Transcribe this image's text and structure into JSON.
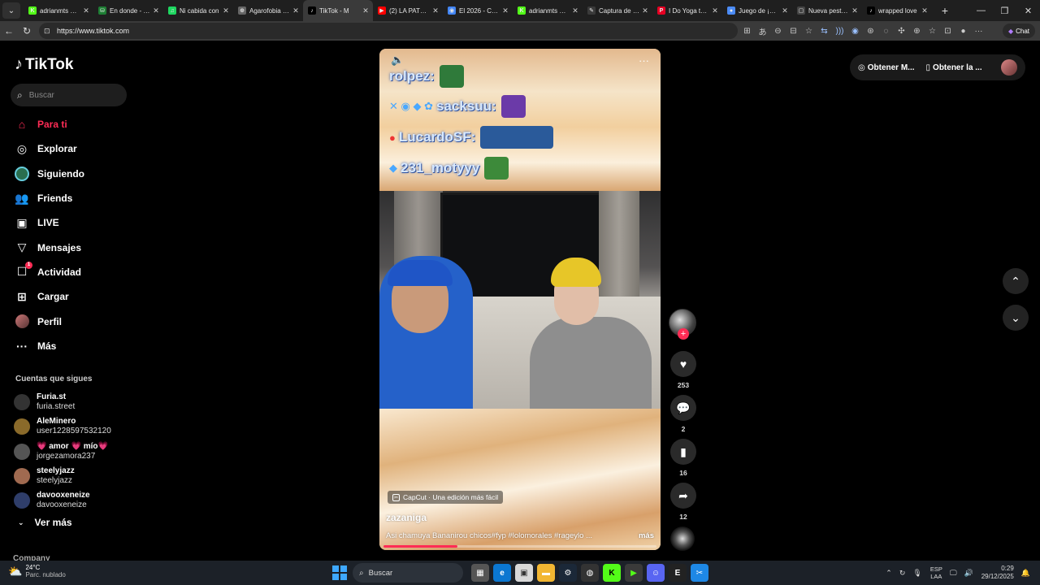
{
  "browser": {
    "tabs": [
      {
        "label": "adrianmts Stre",
        "fav_color": "#53fc18",
        "fav_glyph": "K"
      },
      {
        "label": "En donde - en",
        "fav_color": "#1e7e34",
        "fav_glyph": "⛁"
      },
      {
        "label": "Ni cabida con ",
        "fav_color": "#1ed760",
        "fav_glyph": "♫"
      },
      {
        "label": "Agarofobia del ",
        "fav_color": "#666666",
        "fav_glyph": "⊕"
      },
      {
        "label": "TikTok - M",
        "fav_color": "#000000",
        "fav_glyph": "♪",
        "active": true
      },
      {
        "label": "(2) LA PATRULL",
        "fav_color": "#ff0000",
        "fav_glyph": "▶"
      },
      {
        "label": "El 2026 - Collag",
        "fav_color": "#4285f4",
        "fav_glyph": "◉"
      },
      {
        "label": "adrianmts Stre",
        "fav_color": "#53fc18",
        "fav_glyph": "K"
      },
      {
        "label": "Captura de pan",
        "fav_color": "#3a3a3a",
        "fav_glyph": "✎"
      },
      {
        "label": "I Do Yoga to Ki",
        "fav_color": "#e60023",
        "fav_glyph": "P"
      },
      {
        "label": "Juego de ¡Basta",
        "fav_color": "#4b8bf5",
        "fav_glyph": "●"
      },
      {
        "label": "Nueva pestaña",
        "fav_color": "#444444",
        "fav_glyph": "▢"
      },
      {
        "label": "wrapped love ",
        "fav_color": "#000000",
        "fav_glyph": "♪"
      }
    ],
    "url": "https://www.tiktok.com",
    "copilot_label": "Chat"
  },
  "sidebar": {
    "brand": "TikTok",
    "search_placeholder": "Buscar",
    "nav": [
      {
        "label": "Para ti",
        "icon": "home-icon",
        "glyph": "⌂",
        "active": true
      },
      {
        "label": "Explorar",
        "icon": "compass-icon",
        "glyph": "◎"
      },
      {
        "label": "Siguiendo",
        "icon": "following-avatar-icon",
        "glyph": ""
      },
      {
        "label": "Friends",
        "icon": "friends-icon",
        "glyph": "👥"
      },
      {
        "label": "LIVE",
        "icon": "live-icon",
        "glyph": "▣"
      },
      {
        "label": "Mensajes",
        "icon": "messages-icon",
        "glyph": "▽"
      },
      {
        "label": "Actividad",
        "icon": "activity-icon",
        "glyph": "☐",
        "badge": "1"
      },
      {
        "label": "Cargar",
        "icon": "upload-icon",
        "glyph": "⊞"
      },
      {
        "label": "Perfil",
        "icon": "profile-avatar-icon",
        "glyph": ""
      },
      {
        "label": "Más",
        "icon": "more-icon",
        "glyph": "···"
      }
    ],
    "following_title": "Cuentas que sigues",
    "following": [
      {
        "name": "Furia.st",
        "user": "furia.street",
        "color": "#333333"
      },
      {
        "name": "AleMinero",
        "user": "user1228597532120",
        "color": "#8a6a2a"
      },
      {
        "name": "💗 amor 💗 mío💗",
        "user": "jorgezamora237",
        "color": "#555555"
      },
      {
        "name": "steelyjazz",
        "user": "steelyjazz",
        "color": "#a06a50"
      },
      {
        "name": "davooxeneize",
        "user": "davooxeneize",
        "color": "#2f3e6a"
      }
    ],
    "see_more": "Ver más",
    "company": "Company"
  },
  "header_right": {
    "get_app_1": "Obtener M...",
    "get_app_2": "Obtener la ..."
  },
  "video": {
    "chat": [
      {
        "name": "rolpez:"
      },
      {
        "name": "sacksuu:"
      },
      {
        "name": "LucardoSF:"
      },
      {
        "name": "231_motyyy"
      }
    ],
    "capcut_label": "CapCut · Una edición más fácil",
    "author": "zazaniga",
    "caption": "Asi chamuya Bananirou chicos#fyp #lolomorales #rageylo ...",
    "more_label": "más",
    "progress": 0.27
  },
  "actions": {
    "likes": "253",
    "comments": "2",
    "saves": "16",
    "shares": "12"
  },
  "taskbar": {
    "temp": "24°C",
    "weather_desc": "Parc. nublado",
    "search_label": "Buscar",
    "lang_1": "ESP",
    "lang_2": "LAA",
    "time": "0:29",
    "date": "29/12/2025"
  }
}
